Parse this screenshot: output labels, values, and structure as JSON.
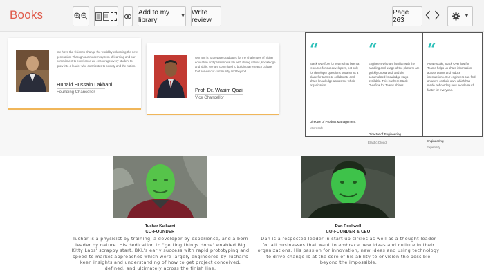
{
  "toolbar": {
    "brand": "Books",
    "add_library_label": "Add to my library",
    "write_review_label": "Write review",
    "page_label": "Page 263",
    "icons": [
      "zoom-in-icon",
      "zoom-out-icon",
      "single-page-icon",
      "two-page-icon",
      "fullscreen-icon",
      "link-icon",
      "caret-down-icon",
      "chevron-left-icon",
      "chevron-right-icon",
      "gear-icon"
    ]
  },
  "leaders": [
    {
      "name": "Hunaid Hussain Lakhani",
      "role": "Founding Chancellor",
      "description": "We have the vision to change the world by educating the new generation. Through our modern system of learning and our commitment to excellence we encourage every student to grow into a leader who contributes to society and the nation."
    },
    {
      "name": "Prof. Dr. Wasim Qazi",
      "role": "Vice Chancellor",
      "description": "Our aim is to prepare graduates for the challenges of higher education and professional life with strong values, knowledge and skills. We are committed to building a research culture that serves our community and beyond."
    }
  ],
  "testimonials": [
    {
      "quote_mark": "“",
      "text": "Stack Overflow for Teams has been a resource for our developers, not only for developer questions but also as a place for teams to collaborate and share knowledge across the whole organization.",
      "author": "Director of Product Management",
      "company": "Microsoft"
    },
    {
      "quote_mark": "“",
      "text": "Engineers who are familiar with the handling and usage of the platform are quickly onboarded, and the accumulated knowledge stays available. This is where Stack Overflow for Teams shines.",
      "author": "Director of Engineering",
      "company": "Elastic Cloud"
    },
    {
      "quote_mark": "“",
      "text": "As we scale, Stack Overflow for Teams helps us share information across teams and reduce interruptions. Our engineers can find answers on their own, which has made onboarding new people much faster for everyone.",
      "author": "Engineering",
      "company": "Expensify"
    }
  ],
  "founders": [
    {
      "name": "Tushar Kulkarni",
      "role": "CO-FOUNDER",
      "bio": "Tushar is a physicist by training, a developer by experience, and a born leader by nature. His dedication to \"getting things done\" enabled Big Kitty Labs' scrappy start. BKL's early success with rapid prototyping and speed to market approaches which were largely engineered by Tushar's keen insights and understanding of how to get project conceived, defined, and ultimately across the finish line."
    },
    {
      "name": "Dan Rockwell",
      "role": "CO-FOUNDER & CEO",
      "bio": "Dan is a respected leader in start up circles as well as a thought leader for all businesses that want to embrace new ideas and culture in their organizations. His passion for innovation, new ideas and using technology to drive change is at the core of his ability to envision the possible beyond the impossible."
    }
  ],
  "colors": {
    "brand": "#e05b4b",
    "accent_teal": "#2bbfb8",
    "card_underline": "#f0b65a",
    "founder_tint": "#3ec24a"
  }
}
